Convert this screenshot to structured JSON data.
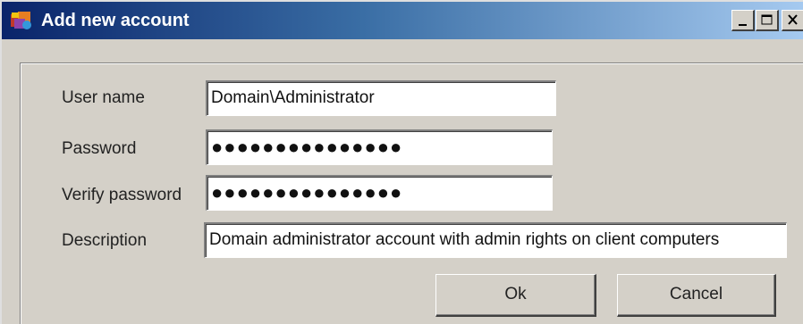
{
  "window": {
    "title": "Add new account",
    "caption_buttons": {
      "minimize_icon": "minimize-icon",
      "maximize_icon": "maximize-icon",
      "close_icon": "close-icon"
    }
  },
  "form": {
    "username": {
      "label": "User name",
      "value": "Domain\\Administrator"
    },
    "password": {
      "label": "Password",
      "value": "●●●●●●●●●●●●●●●"
    },
    "verify_password": {
      "label": "Verify password",
      "value": "●●●●●●●●●●●●●●●"
    },
    "description": {
      "label": "Description",
      "value": "Domain administrator account with admin rights on client computers"
    }
  },
  "buttons": {
    "ok_label": "Ok",
    "cancel_label": "Cancel"
  },
  "colors": {
    "titlebar_start": "#0a246a",
    "titlebar_end": "#a6caf0",
    "face": "#d4d0c8"
  }
}
